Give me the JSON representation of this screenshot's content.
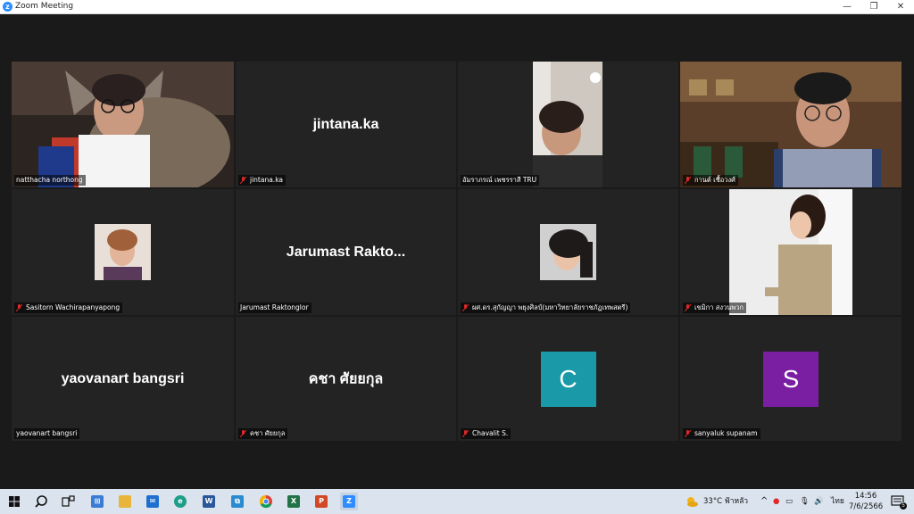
{
  "window": {
    "title": "Zoom Meeting",
    "minimize": "—",
    "restore": "❐",
    "close": "✕"
  },
  "participants": [
    {
      "display_name": "natthacha northong",
      "label": "natthacha northong",
      "muted": false,
      "video": true,
      "active_speaker": true
    },
    {
      "display_name": "jintana.ka",
      "label": "jintana.ka",
      "muted": true,
      "video": false
    },
    {
      "display_name": "อัมราภรณ์ เพชรราสี TRU",
      "label": "อัมราภรณ์ เพชรราสี TRU",
      "muted": false,
      "video": true
    },
    {
      "display_name": "กานต์ เชื้อวงศ์",
      "label": "กานต์ เชื้อวงศ์",
      "muted": true,
      "video": true
    },
    {
      "display_name": "Sasitorn Wachirapanyapong",
      "label": "Sasitorn Wachirapanyapong",
      "muted": true,
      "video": true
    },
    {
      "display_name": "Jarumast  Rakto...",
      "label": "Jarumast Raktonglor",
      "muted": false,
      "video": false
    },
    {
      "display_name": "ผศ.ดร.สุกัญญา พยุงศิลป์(มหาวิทยาลัยราชภัฏเทพสตรี)",
      "label": "ผศ.ดร.สุกัญญา พยุงศิลป์(มหาวิทยาลัยราชภัฏเทพสตรี)",
      "muted": true,
      "video": true
    },
    {
      "display_name": "เขมิกา สงวนพวก",
      "label": "เขมิกา สงวนพวก",
      "muted": true,
      "video": true
    },
    {
      "display_name": "yaovanart bangsri",
      "label": "yaovanart bangsri",
      "muted": false,
      "video": false
    },
    {
      "display_name": "คชา ศัยยกุล",
      "label": "คชา ศัยยกุล",
      "muted": true,
      "video": false
    },
    {
      "display_name": "C",
      "label": "Chavalit S.",
      "muted": true,
      "video": false,
      "avatar_color": "#1a9aa8"
    },
    {
      "display_name": "S",
      "label": "sanyaluk supanam",
      "muted": true,
      "video": false,
      "avatar_color": "#7b1fa2"
    }
  ],
  "taskbar": {
    "apps": [
      "start",
      "search",
      "task-view",
      "store",
      "file-explorer",
      "mail",
      "edge",
      "word",
      "clipboard",
      "chrome",
      "excel",
      "powerpoint",
      "zoom"
    ],
    "weather": "33°C  ฟ้าหลัว",
    "language": "ไทย",
    "time": "14:56",
    "date": "7/6/2566",
    "notification_count": "5"
  },
  "colors": {
    "active_speaker_border": "#a6e05c",
    "muted_icon": "#e02828",
    "zoom_blue": "#2d8cff"
  }
}
